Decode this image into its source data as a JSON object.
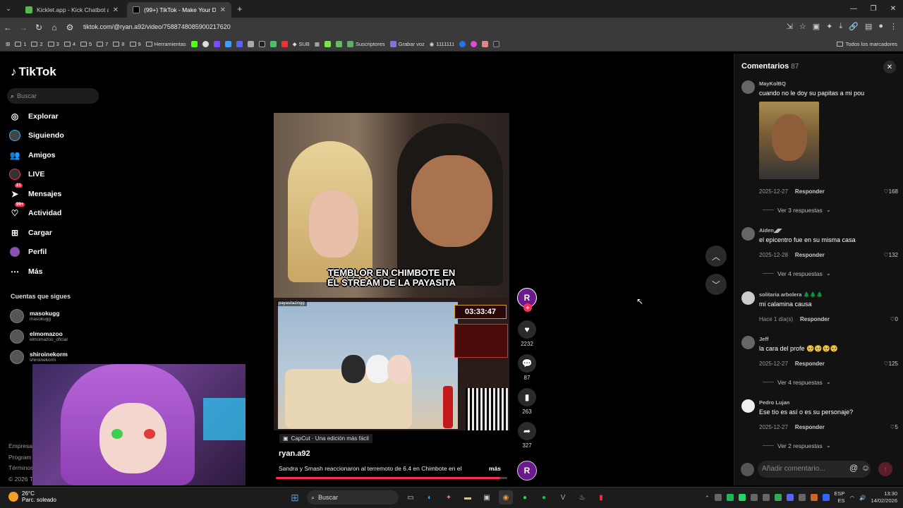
{
  "browser": {
    "tabs": [
      {
        "title": "Kicklet.app - Kick Chatbot and",
        "active": false
      },
      {
        "title": "(99+) TikTok - Make Your Day",
        "active": true
      }
    ],
    "url": "tiktok.com/@ryan.a92/video/7588748085900217620",
    "bookmarks": [
      "1",
      "2",
      "3",
      "4",
      "5",
      "7",
      "8",
      "9",
      "Herramientas",
      "SUB",
      "Suscriptores",
      "Grabar voz",
      "1111111"
    ],
    "bookmarks_all": "Todos los marcadores"
  },
  "sidebar": {
    "logo": "TikTok",
    "search_placeholder": "Buscar",
    "items": [
      {
        "label": "Explorar",
        "icon": "compass-icon"
      },
      {
        "label": "Siguiendo",
        "icon": "following-icon"
      },
      {
        "label": "Amigos",
        "icon": "friends-icon"
      },
      {
        "label": "LIVE",
        "icon": "live-icon"
      },
      {
        "label": "Mensajes",
        "icon": "messages-icon",
        "badge": "21"
      },
      {
        "label": "Actividad",
        "icon": "activity-icon",
        "badge": "99+"
      },
      {
        "label": "Cargar",
        "icon": "upload-icon"
      },
      {
        "label": "Perfil",
        "icon": "profile-icon"
      },
      {
        "label": "Más",
        "icon": "more-icon"
      }
    ],
    "following_title": "Cuentas que sigues",
    "following": [
      {
        "name": "masokugg",
        "handle": "masokugg"
      },
      {
        "name": "elmomazoo",
        "handle": "elmomazoo_oficial"
      },
      {
        "name": "shiroinekorm",
        "handle": "shiroinekorm"
      }
    ],
    "footer": [
      "Empresa",
      "Program",
      "Términos",
      "© 2026 T"
    ]
  },
  "video": {
    "caption": "TEMBLOR EN CHIMBOTE EN\nEL STREAM DE LA PAYASITA",
    "stream_tag": "payasitazingg",
    "timer": "03:33:47",
    "capcut": "CapCut · Una edición más fácil",
    "author": "ryan.a92",
    "description": "Sandra y Smash reaccionaron al terremoto de 6.4 en Chimbote en el",
    "more": "más",
    "progress": 0.97
  },
  "actions": {
    "likes": "2232",
    "comments": "87",
    "saves": "263",
    "shares": "327",
    "avatar_letter": "R"
  },
  "comments": {
    "title": "Comentarios",
    "count": "87",
    "items": [
      {
        "user": "MayKolBQ",
        "text": "cuando no le doy su papitas a mi pou",
        "date": "2025-12-27",
        "reply": "Responder",
        "likes": "168",
        "view_replies": "Ver 3 respuestas"
      },
      {
        "user": "Aiden◢◤",
        "text": "el epicentro fue en su misma casa",
        "date": "2025-12-28",
        "reply": "Responder",
        "likes": "132",
        "view_replies": "Ver 4 respuestas"
      },
      {
        "user": "solitaria arbolera 🌲🌲🌲",
        "text": "mi calamina causa",
        "date": "Hace 1 día(s)",
        "reply": "Responder",
        "likes": "0"
      },
      {
        "user": "Jeff",
        "text": "la cara del profe 🥺🥺🥺🥺",
        "date": "2025-12-27",
        "reply": "Responder",
        "likes": "125",
        "view_replies": "Ver 4 respuestas"
      },
      {
        "user": "Pedro Lujan",
        "text": "Ese tío es así o es su personaje?",
        "date": "2025-12-27",
        "reply": "Responder",
        "likes": "5",
        "view_replies": "Ver 2 respuestas"
      }
    ],
    "input_placeholder": "Añadir comentario..."
  },
  "taskbar": {
    "temp": "26°C",
    "weather": "Parc. soleado",
    "search": "Buscar",
    "lang1": "ESP",
    "lang2": "ES",
    "time": "13:30",
    "date": "14/02/2026"
  }
}
